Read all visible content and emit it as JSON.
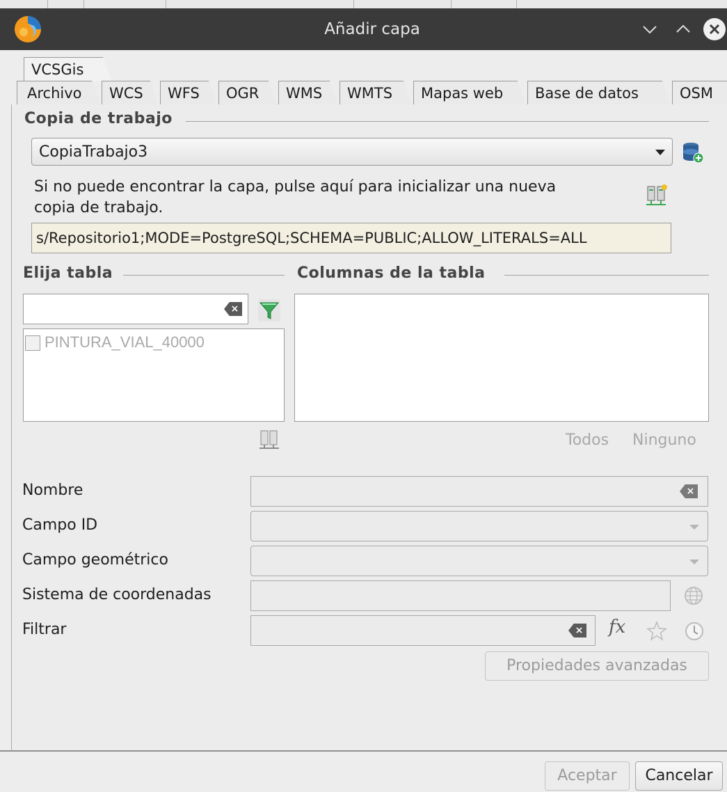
{
  "window": {
    "title": "Añadir capa",
    "buttons": {
      "minimize": "∨",
      "maximize": "∧",
      "close": "✕"
    },
    "icon": "gvsig-app-icon"
  },
  "tabs": {
    "top_row": [
      {
        "label": "VCSGis",
        "active": true
      }
    ],
    "bottom_row": [
      {
        "label": "Archivo"
      },
      {
        "label": "WCS"
      },
      {
        "label": "WFS"
      },
      {
        "label": "OGR"
      },
      {
        "label": "WMS"
      },
      {
        "label": "WMTS"
      },
      {
        "label": "Mapas web"
      },
      {
        "label": "Base de datos"
      },
      {
        "label": "OSM"
      }
    ]
  },
  "working_copy": {
    "section_title": "Copia de trabajo",
    "selected": "CopiaTrabajo3",
    "add_icon": "database-add-icon",
    "hint": "Si no puede encontrar la capa, pulse aquí para inicializar una nueva copia de trabajo.",
    "hint_line1": "Si no puede encontrar la capa, pulse aquí para inicializar una nueva",
    "hint_line2": "copia de trabajo.",
    "init_icon": "server-connect-icon",
    "connection_string": "s/Repositorio1;MODE=PostgreSQL;SCHEMA=PUBLIC;ALLOW_LITERALS=ALL"
  },
  "tables": {
    "section_title": "Elija tabla",
    "search_value": "",
    "filter_icon": "filter-funnel-icon",
    "items": [
      {
        "name": "PINTURA_VIAL_40000",
        "checked": false
      }
    ],
    "refresh_icon": "server-connect-icon"
  },
  "columns": {
    "section_title": "Columnas de la tabla",
    "items": [],
    "select_all": "Todos",
    "select_none": "Ninguno"
  },
  "form": {
    "name_label": "Nombre",
    "name_value": "",
    "id_field_label": "Campo ID",
    "id_field_value": "",
    "geom_field_label": "Campo geométrico",
    "geom_field_value": "",
    "crs_label": "Sistema de coordenadas",
    "crs_value": "",
    "filter_label": "Filtrar",
    "filter_value": "",
    "filter_expression_icon": "fx",
    "favorite_icon": "star-icon",
    "history_icon": "clock-icon",
    "crs_icon": "globe-icon",
    "advanced_button": "Propiedades avanzadas"
  },
  "footer": {
    "accept": "Aceptar",
    "cancel": "Cancelar"
  },
  "colors": {
    "titlebar": "#3a3a3a",
    "panel": "#ececec",
    "connection_bg": "#f3f0e2",
    "filter_green": "#3aa757"
  }
}
